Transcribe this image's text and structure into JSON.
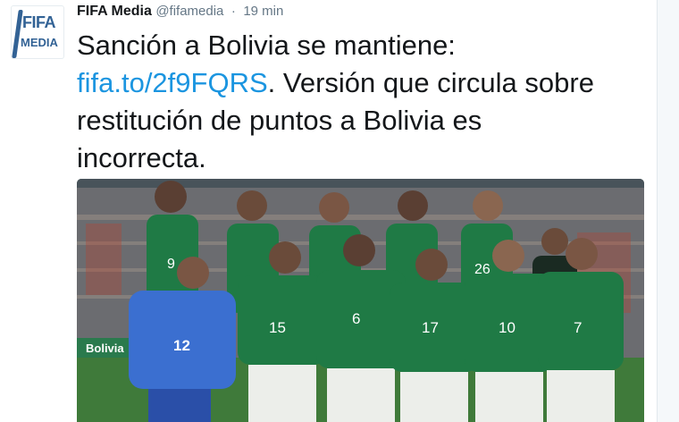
{
  "tweet": {
    "author_name": "FIFA Media",
    "author_handle": "@fifamedia",
    "separator": "·",
    "timestamp": "19 min",
    "text_line1": "Sanción a Bolivia se mantiene:",
    "link_text": "fifa.to/2f9FQRS",
    "text_line2_rest": ". Versión que circula sobre",
    "text_line3": "restitución de puntos a Bolivia es",
    "text_line4": "incorrecta."
  },
  "avatar": {
    "logo_word": "FIFA",
    "logo_subword": "MEDIA"
  },
  "media": {
    "description_icon": "team-photo",
    "banner_text": "Bolivia",
    "jersey_numbers_back": [
      "9",
      "26"
    ],
    "jersey_numbers_front": [
      "12",
      "15",
      "6",
      "17",
      "10",
      "7"
    ]
  },
  "colors": {
    "link": "#1b95e0",
    "brand": "#326295",
    "bolivia_green": "#1f7a45",
    "goalkeeper_blue": "#3b6fd0"
  }
}
